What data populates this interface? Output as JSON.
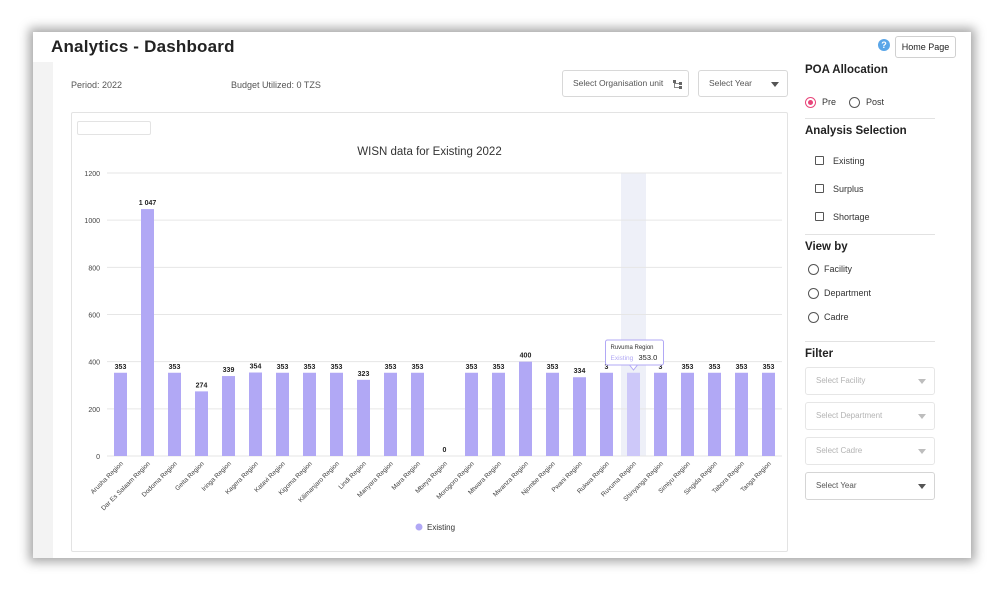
{
  "header": {
    "title": "Analytics - Dashboard",
    "help_icon": "question-circle-icon",
    "home_label": "Home Page"
  },
  "summary": {
    "period": "Period: 2022",
    "budget": "Budget Utilized: 0 TZS"
  },
  "filters_top": {
    "org_unit_placeholder": "Select Organisation unit",
    "year_placeholder": "Select Year"
  },
  "chart_data": {
    "type": "bar",
    "title": "WISN data for Existing 2022",
    "categories": [
      "Arusha Region",
      "Dar Es Salaam Region",
      "Dodoma Region",
      "Geita Region",
      "Iringa Region",
      "Kagera Region",
      "Katavi Region",
      "Kigoma Region",
      "Kilimanjaro Region",
      "Lindi Region",
      "Manyara Region",
      "Mara Region",
      "Mbeya Region",
      "Morogoro Region",
      "Mtwara Region",
      "Mwanza Region",
      "Njombe Region",
      "Pwani Region",
      "Rukwa Region",
      "Ruvuma Region",
      "Shinyanga Region",
      "Simiyu Region",
      "Singida Region",
      "Tabora Region",
      "Tanga Region"
    ],
    "series": [
      {
        "name": "Existing",
        "values": [
          353,
          1047,
          353,
          274,
          339,
          354,
          353,
          353,
          353,
          323,
          353,
          353,
          0,
          353,
          353,
          400,
          353,
          334,
          353,
          353,
          353,
          353,
          353,
          353,
          353
        ]
      }
    ],
    "data_labels": [
      "353",
      "1 047",
      "353",
      "274",
      "339",
      "354",
      "353",
      "353",
      "353",
      "323",
      "353",
      "353",
      "0",
      "353",
      "353",
      "400",
      "353",
      "334",
      "3",
      "",
      "3",
      "353",
      "353",
      "353",
      "353"
    ],
    "yticks": [
      "0",
      "200",
      "400",
      "600",
      "800",
      "1000",
      "1200"
    ],
    "ylim": [
      0,
      1200
    ],
    "grid": true,
    "legend": "bottom",
    "legend_label": "Existing",
    "colors": {
      "bar": "#b1a8f5",
      "bar_hover": "#cdc8f9",
      "highlight": "#eef0f8"
    },
    "tooltip": {
      "title": "Ruvuma Region",
      "series": "Existing",
      "value": "353.0"
    }
  },
  "sidebar": {
    "poa_title": "POA Allocation",
    "poa_options": [
      "Pre",
      "Post"
    ],
    "poa_selected": "Pre",
    "analysis_title": "Analysis Selection",
    "analysis_options": [
      "Existing",
      "Surplus",
      "Shortage"
    ],
    "view_title": "View by",
    "view_options": [
      "Facility",
      "Department",
      "Cadre"
    ],
    "filter_title": "Filter",
    "filter_selects": [
      "Select Facility",
      "Select Department",
      "Select Cadre",
      "Select Year"
    ]
  }
}
